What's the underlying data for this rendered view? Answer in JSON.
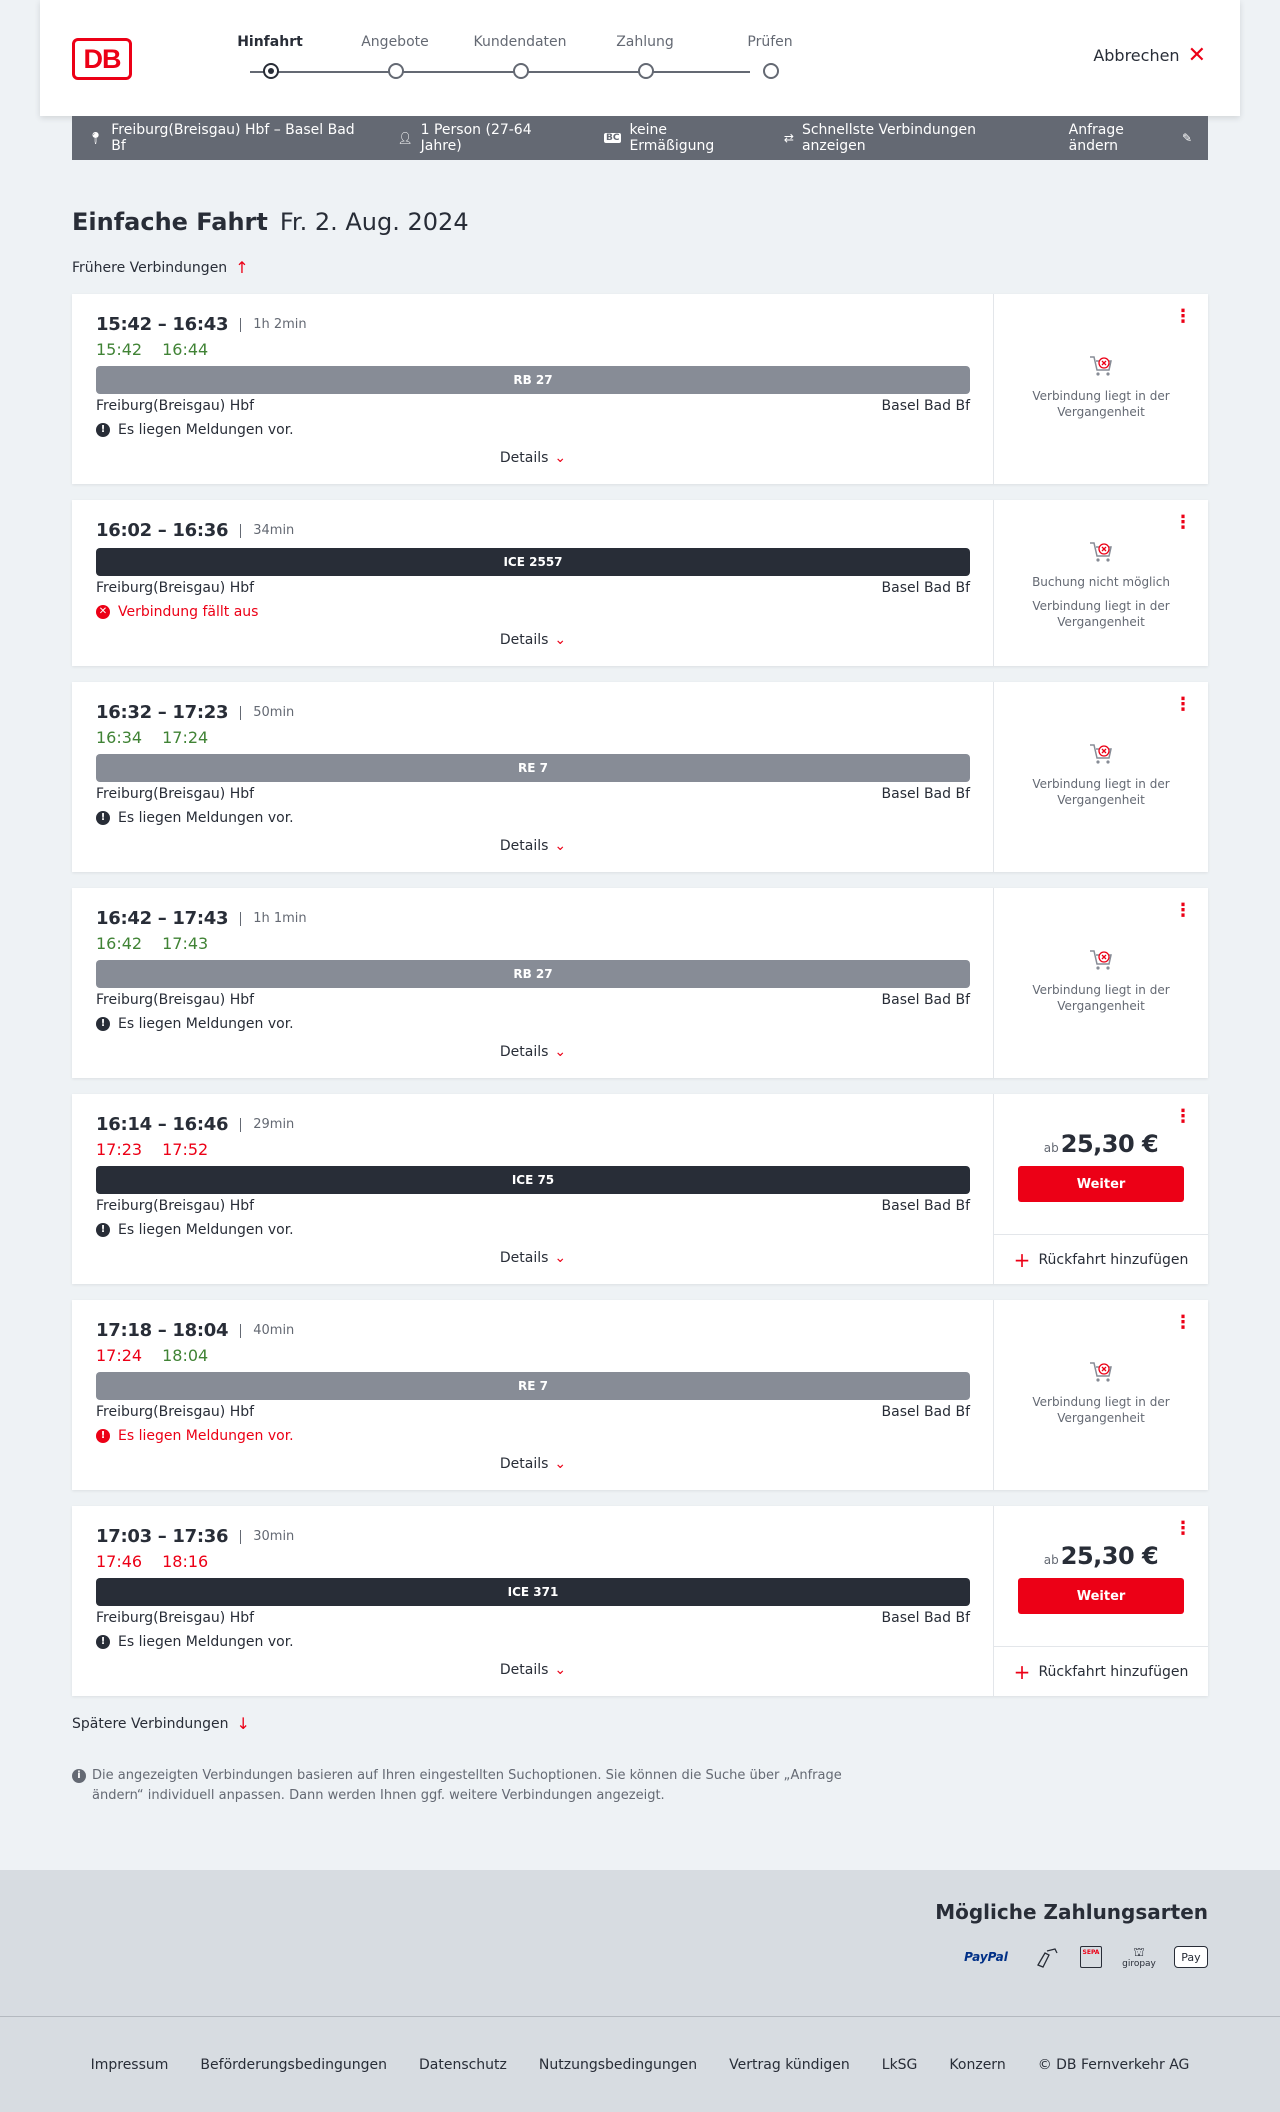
{
  "header": {
    "logo_text": "DB",
    "steps": [
      "Hinfahrt",
      "Angebote",
      "Kundendaten",
      "Zahlung",
      "Prüfen"
    ],
    "active_step": "Hinfahrt",
    "cancel_label": "Abbrechen"
  },
  "summary": {
    "route": "Freiburg(Breisgau) Hbf – Basel Bad Bf",
    "persons": "1 Person (27-64 Jahre)",
    "bc_badge": "BC",
    "discount": "keine Ermäßigung",
    "fastest": "Schnellste Verbindungen anzeigen",
    "change": "Anfrage ändern"
  },
  "title": {
    "type": "Einfache Fahrt",
    "date": "Fr. 2. Aug. 2024"
  },
  "earlier_label": "Frühere Verbindungen",
  "later_label": "Spätere Verbindungen",
  "details_label": "Details",
  "weiter_label": "Weiter",
  "return_label": "Rückfahrt hinzufügen",
  "price_prefix": "ab",
  "connections": [
    {
      "times": "15:42 – 16:43",
      "duration": "1h 2min",
      "rt_dep": "15:42",
      "rt_arr": "16:44",
      "rt_dep_status": "ok",
      "rt_arr_status": "ok",
      "train": "RB 27",
      "train_type": "regional",
      "from": "Freiburg(Breisgau) Hbf",
      "to": "Basel Bad Bf",
      "message": "Es liegen Meldungen vor.",
      "message_style": "info",
      "status_lines": [
        "Verbindung liegt in der Vergangenheit"
      ]
    },
    {
      "times": "16:02 – 16:36",
      "duration": "34min",
      "train": "ICE 2557",
      "train_type": "ice",
      "from": "Freiburg(Breisgau) Hbf",
      "to": "Basel Bad Bf",
      "message": "Verbindung fällt aus",
      "message_style": "cancel",
      "status_lines": [
        "Buchung nicht möglich",
        "Verbindung liegt in der Vergangenheit"
      ]
    },
    {
      "times": "16:32 – 17:23",
      "duration": "50min",
      "rt_dep": "16:34",
      "rt_arr": "17:24",
      "rt_dep_status": "ok",
      "rt_arr_status": "ok",
      "train": "RE 7",
      "train_type": "regional",
      "from": "Freiburg(Breisgau) Hbf",
      "to": "Basel Bad Bf",
      "message": "Es liegen Meldungen vor.",
      "message_style": "info",
      "status_lines": [
        "Verbindung liegt in der Vergangenheit"
      ]
    },
    {
      "times": "16:42 – 17:43",
      "duration": "1h 1min",
      "rt_dep": "16:42",
      "rt_arr": "17:43",
      "rt_dep_status": "ok",
      "rt_arr_status": "ok",
      "train": "RB 27",
      "train_type": "regional",
      "from": "Freiburg(Breisgau) Hbf",
      "to": "Basel Bad Bf",
      "message": "Es liegen Meldungen vor.",
      "message_style": "info",
      "status_lines": [
        "Verbindung liegt in der Vergangenheit"
      ]
    },
    {
      "times": "16:14 – 16:46",
      "duration": "29min",
      "rt_dep": "17:23",
      "rt_arr": "17:52",
      "rt_dep_status": "late",
      "rt_arr_status": "late",
      "train": "ICE 75",
      "train_type": "ice",
      "from": "Freiburg(Breisgau) Hbf",
      "to": "Basel Bad Bf",
      "message": "Es liegen Meldungen vor.",
      "message_style": "info",
      "price": "25,30 €"
    },
    {
      "times": "17:18 – 18:04",
      "duration": "40min",
      "rt_dep": "17:24",
      "rt_arr": "18:04",
      "rt_dep_status": "late",
      "rt_arr_status": "ok",
      "train": "RE 7",
      "train_type": "regional",
      "from": "Freiburg(Breisgau) Hbf",
      "to": "Basel Bad Bf",
      "message": "Es liegen Meldungen vor.",
      "message_style": "warn",
      "status_lines": [
        "Verbindung liegt in der Vergangenheit"
      ]
    },
    {
      "times": "17:03 – 17:36",
      "duration": "30min",
      "rt_dep": "17:46",
      "rt_arr": "18:16",
      "rt_dep_status": "late",
      "rt_arr_status": "late",
      "train": "ICE 371",
      "train_type": "ice",
      "from": "Freiburg(Breisgau) Hbf",
      "to": "Basel Bad Bf",
      "message": "Es liegen Meldungen vor.",
      "message_style": "info",
      "price": "25,30 €"
    }
  ],
  "info_note": "Die angezeigten Verbindungen basieren auf Ihren eingestellten Suchoptionen. Sie können die Suche über „Anfrage ändern“ individuell anpassen. Dann werden Ihnen ggf. weitere Verbindungen angezeigt.",
  "payment": {
    "title": "Mögliche Zahlungsarten",
    "methods": [
      {
        "icon": "paypal-icon",
        "label": "PayPal"
      },
      {
        "icon": "creditcard-icon",
        "label": ""
      },
      {
        "icon": "sepa-icon",
        "label": "SEPA"
      },
      {
        "icon": "giropay-icon",
        "label": "giropay"
      },
      {
        "icon": "applepay-icon",
        "label": "Pay"
      }
    ]
  },
  "footer": {
    "links": [
      "Impressum",
      "Beförderungsbedingungen",
      "Datenschutz",
      "Nutzungsbedingungen",
      "Vertrag kündigen",
      "LkSG",
      "Konzern",
      "© DB Fernverkehr AG"
    ]
  },
  "colors": {
    "brand_red": "#ec0016",
    "ontime_green": "#408335",
    "ice_bar": "#282d37",
    "regional_bar": "#878c96"
  }
}
